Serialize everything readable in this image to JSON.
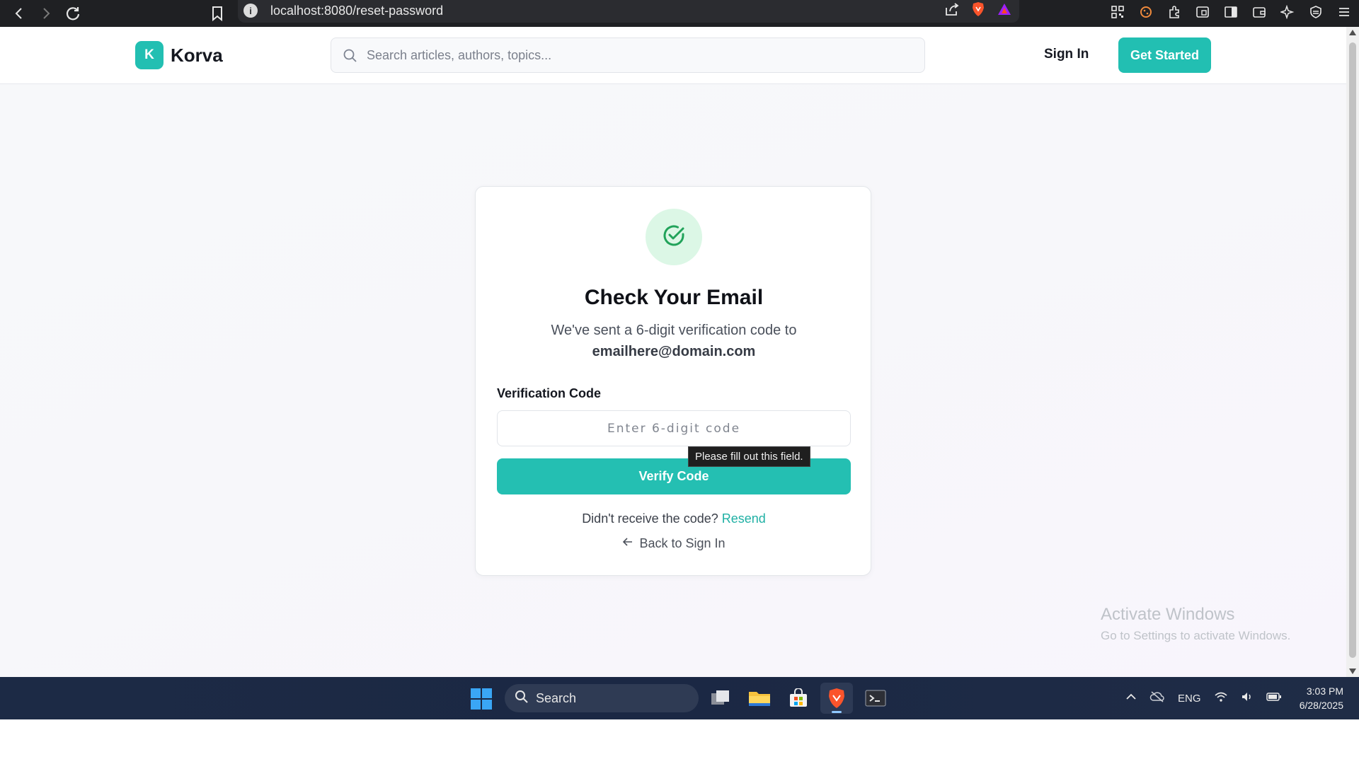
{
  "browser": {
    "url": "localhost:8080/reset-password"
  },
  "header": {
    "logo_letter": "K",
    "brand": "Korva",
    "search_placeholder": "Search articles, authors, topics...",
    "signin_label": "Sign In",
    "get_started_label": "Get Started"
  },
  "card": {
    "title": "Check Your Email",
    "subtitle": "We've sent a 6-digit verification code to",
    "email": "emailhere@domain.com",
    "field_label": "Verification Code",
    "code_placeholder": "Enter 6-digit code",
    "code_value": "",
    "verify_label": "Verify Code",
    "tooltip": "Please fill out this field.",
    "resend_prompt": "Didn't receive the code?",
    "resend_link": "Resend",
    "back_label": "Back to Sign In"
  },
  "watermark": {
    "title": "Activate Windows",
    "subtitle": "Go to Settings to activate Windows."
  },
  "taskbar": {
    "search_label": "Search",
    "language": "ENG",
    "time": "3:03 PM",
    "date": "6/28/2025"
  },
  "colors": {
    "accent": "#22bfb2",
    "check_bg": "#dcf7e6",
    "check_stroke": "#21a35a"
  }
}
